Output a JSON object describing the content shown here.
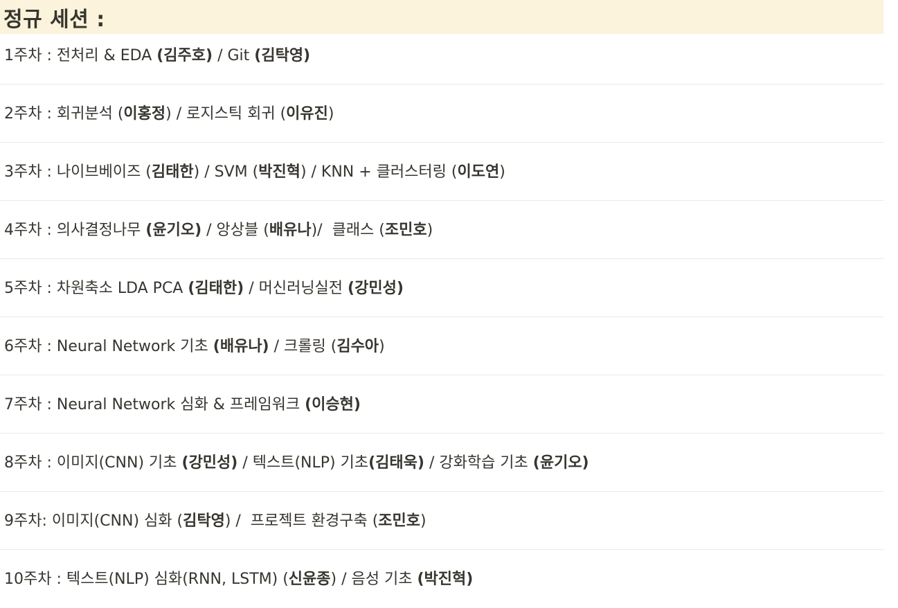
{
  "heading": "정규 세션 :",
  "rows": [
    [
      {
        "t": "1주차 : 전처리 & EDA ",
        "b": false
      },
      {
        "t": "(김주호)",
        "b": true
      },
      {
        "t": " / Git ",
        "b": false
      },
      {
        "t": "(김탁영)",
        "b": true
      }
    ],
    [
      {
        "t": "2주차 : 회귀분석 (",
        "b": false
      },
      {
        "t": "이홍정",
        "b": true
      },
      {
        "t": ") / 로지스틱 회귀 (",
        "b": false
      },
      {
        "t": "이유진",
        "b": true
      },
      {
        "t": ")",
        "b": false
      }
    ],
    [
      {
        "t": "3주차 : 나이브베이즈 (",
        "b": false
      },
      {
        "t": "김태한",
        "b": true
      },
      {
        "t": ") / SVM (",
        "b": false
      },
      {
        "t": "박진혁",
        "b": true
      },
      {
        "t": ") / KNN + 클러스터링 (",
        "b": false
      },
      {
        "t": "이도연",
        "b": true
      },
      {
        "t": ")",
        "b": false
      }
    ],
    [
      {
        "t": "4주차 : 의사결정나무 ",
        "b": false
      },
      {
        "t": "(윤기오)",
        "b": true
      },
      {
        "t": " / 앙상블 (",
        "b": false
      },
      {
        "t": "배유나",
        "b": true
      },
      {
        "t": ")/  클래스 (",
        "b": false
      },
      {
        "t": "조민호",
        "b": true
      },
      {
        "t": ")",
        "b": false
      }
    ],
    [
      {
        "t": "5주차 : 차원축소 LDA PCA ",
        "b": false
      },
      {
        "t": "(김태한)",
        "b": true
      },
      {
        "t": " / 머신러닝실전 ",
        "b": false
      },
      {
        "t": "(강민성)",
        "b": true
      }
    ],
    [
      {
        "t": "6주차 : Neural Network 기초 ",
        "b": false
      },
      {
        "t": "(배유나)",
        "b": true
      },
      {
        "t": " / 크롤링 (",
        "b": false
      },
      {
        "t": "김수아",
        "b": true
      },
      {
        "t": ")",
        "b": false
      }
    ],
    [
      {
        "t": "7주차 : Neural Network 심화 & 프레임워크 ",
        "b": false
      },
      {
        "t": "(이승현)",
        "b": true
      }
    ],
    [
      {
        "t": "8주차 : 이미지(CNN) 기초 ",
        "b": false
      },
      {
        "t": "(강민성)",
        "b": true
      },
      {
        "t": " / 텍스트(NLP) 기초",
        "b": false
      },
      {
        "t": "(김태욱)",
        "b": true
      },
      {
        "t": " / 강화학습 기초 ",
        "b": false
      },
      {
        "t": "(윤기오)",
        "b": true
      }
    ],
    [
      {
        "t": "9주차: 이미지(CNN) 심화 (",
        "b": false
      },
      {
        "t": "김탁영",
        "b": true
      },
      {
        "t": ") /  프로젝트 환경구축 (",
        "b": false
      },
      {
        "t": "조민호",
        "b": true
      },
      {
        "t": ")",
        "b": false
      }
    ],
    [
      {
        "t": "10주차 : 텍스트(NLP) 심화(RNN, LSTM) (",
        "b": false
      },
      {
        "t": "신윤종",
        "b": true
      },
      {
        "t": ") / 음성 기초 ",
        "b": false
      },
      {
        "t": "(박진혁)",
        "b": true
      }
    ]
  ]
}
